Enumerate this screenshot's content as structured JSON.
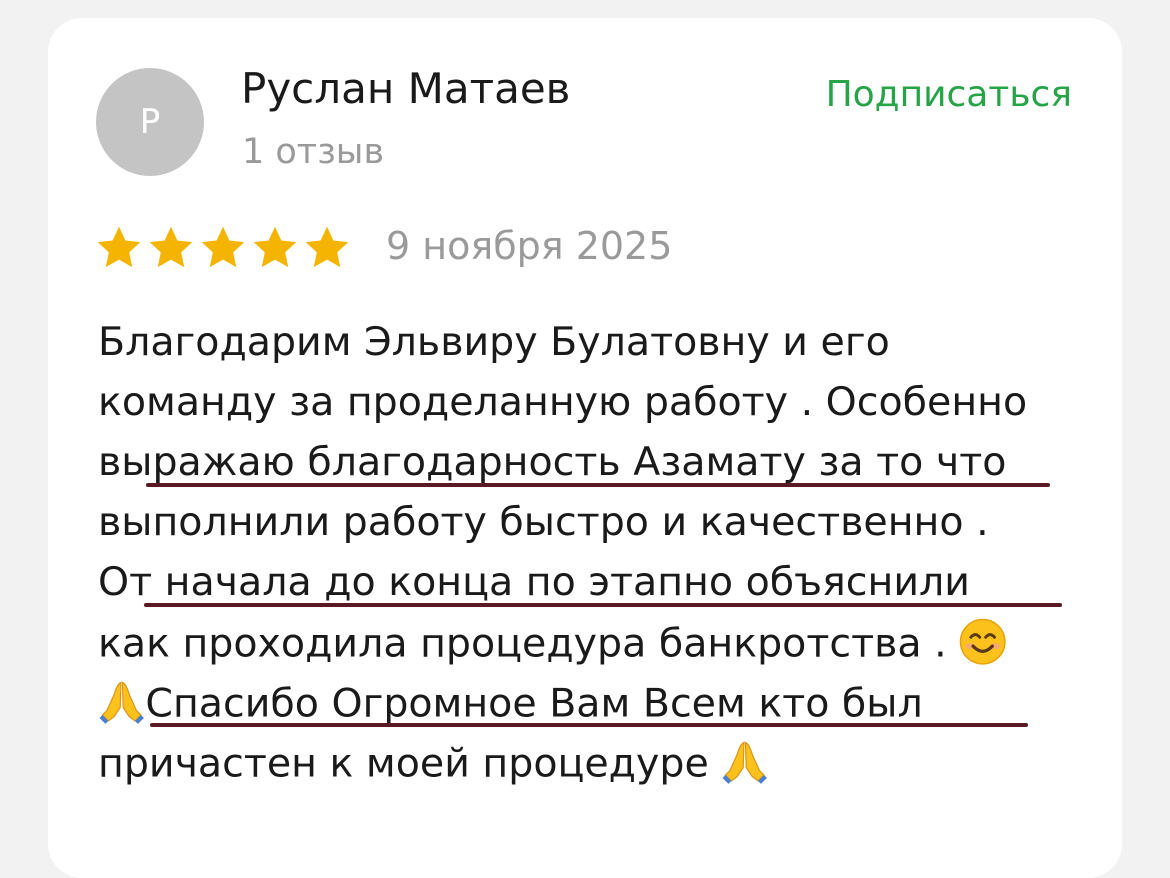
{
  "review": {
    "avatar_letter": "Р",
    "author_name": "Руслан Матаев",
    "review_count": "1 отзыв",
    "subscribe_label": "Подписаться",
    "rating": 5,
    "rating_max": 5,
    "date": "9 ноября 2025",
    "text_lines": [
      "Благодарим Эльвиру Булатовну и его",
      "команду за проделанную работу . Особенно",
      "выражаю благодарность Азамату за то что",
      "выполнили работу быстро и качественно .",
      "От начала до конца по этапно объяснили",
      "как проходила процедура банкротства .",
      "Спасибо Огромное Вам Всем кто был",
      "причастен к моей процедуре "
    ]
  },
  "colors": {
    "star": "#f4b400",
    "subscribe": "#26a447",
    "underline": "#5a1a24"
  },
  "icons": {
    "smile": "smiling-face-emoji",
    "pray": "folded-hands-emoji"
  }
}
